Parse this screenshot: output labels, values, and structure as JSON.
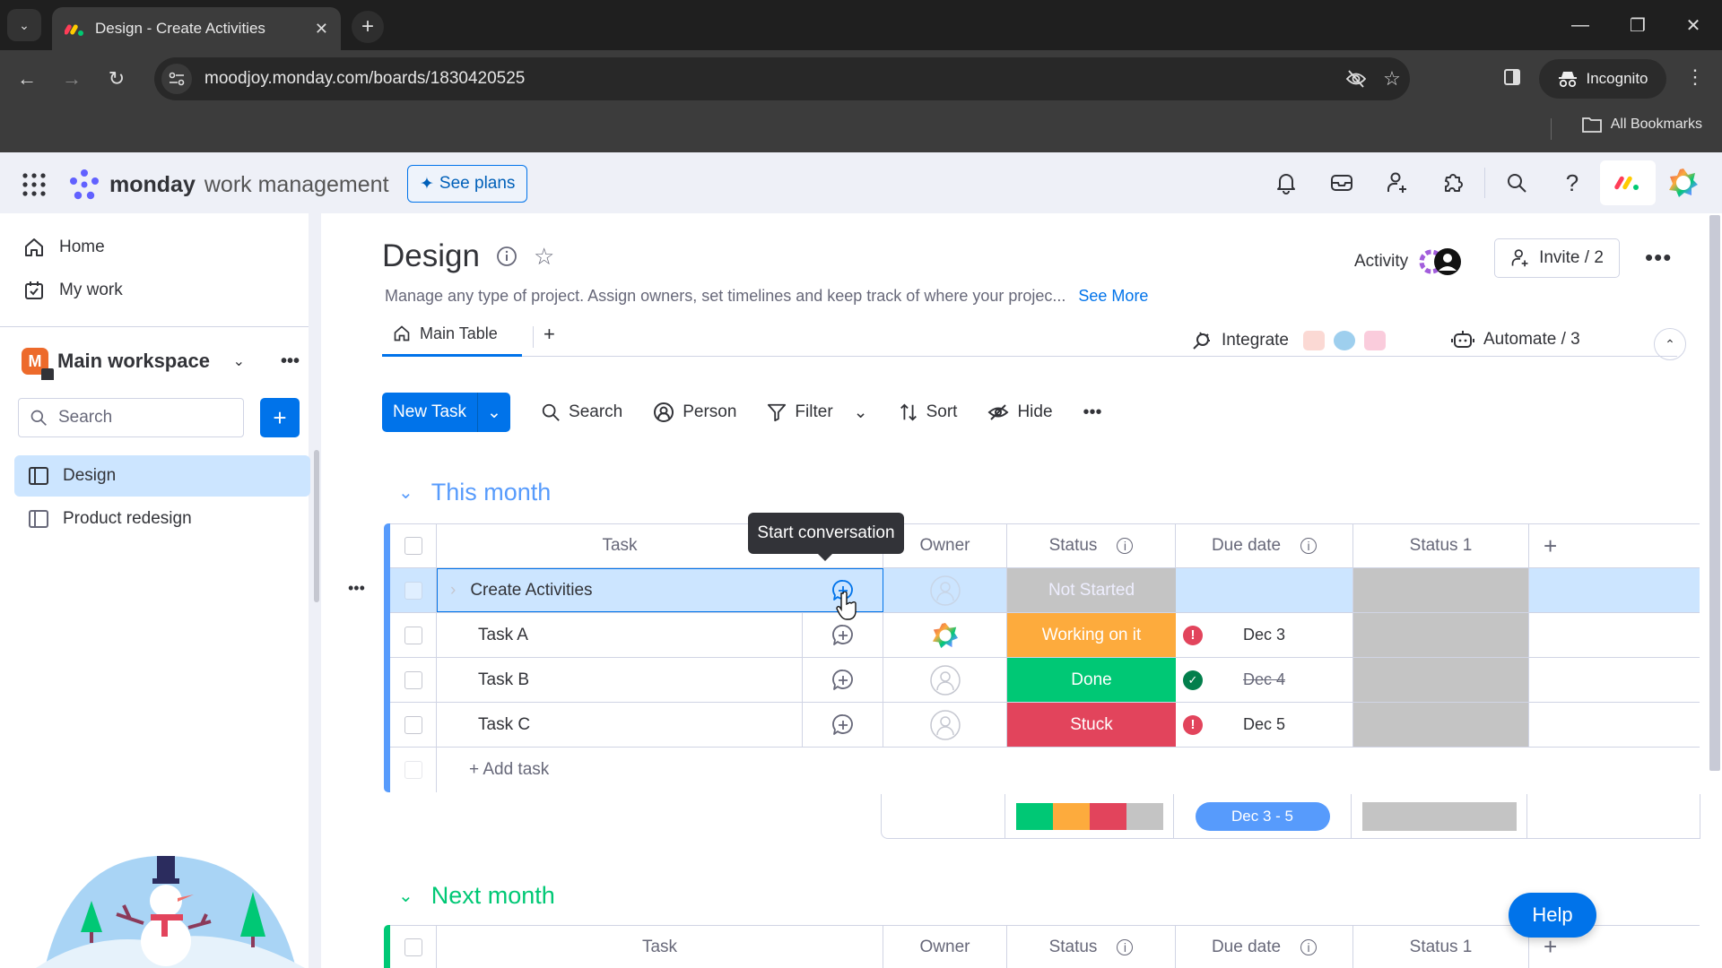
{
  "browser": {
    "tab_title": "Design - Create Activities",
    "url": "moodjoy.monday.com/boards/1830420525",
    "incognito_label": "Incognito",
    "bookmarks_label": "All Bookmarks"
  },
  "app": {
    "brand_bold": "monday",
    "brand_light": "work management",
    "see_plans": "See plans",
    "header_icons": [
      "bell-icon",
      "inbox-icon",
      "invite-members-icon",
      "apps-icon",
      "search-icon",
      "help-icon"
    ]
  },
  "sidebar": {
    "nav": [
      {
        "label": "Home",
        "icon": "home-icon"
      },
      {
        "label": "My work",
        "icon": "calendar-check-icon"
      }
    ],
    "workspace": {
      "badge": "M",
      "name": "Main workspace"
    },
    "search_placeholder": "Search",
    "boards": [
      {
        "label": "Design",
        "selected": true
      },
      {
        "label": "Product redesign",
        "selected": false
      }
    ]
  },
  "board": {
    "title": "Design",
    "description": "Manage any type of project. Assign owners, set timelines and keep track of where your projec...",
    "see_more": "See More",
    "activity_label": "Activity",
    "invite_label": "Invite / 2",
    "tabs": [
      {
        "label": "Main Table",
        "active": true
      }
    ],
    "integrate_label": "Integrate",
    "automate_label": "Automate / 3",
    "actions": {
      "new_task": "New Task",
      "search": "Search",
      "person": "Person",
      "filter": "Filter",
      "sort": "Sort",
      "hide": "Hide"
    },
    "columns": {
      "task": "Task",
      "owner": "Owner",
      "status": "Status",
      "due_date": "Due date",
      "status1": "Status 1"
    },
    "tooltip": "Start conversation",
    "groups": [
      {
        "name": "This month",
        "color": "#579bfc",
        "rows": [
          {
            "task": "Create Activities",
            "owner": "empty",
            "status": "Not Started",
            "status_color": "#c4c4c4",
            "due": "",
            "due_flag": "",
            "selected": true
          },
          {
            "task": "Task A",
            "owner": "avatar",
            "status": "Working on it",
            "status_color": "#fdab3d",
            "due": "Dec 3",
            "due_flag": "overdue",
            "selected": false
          },
          {
            "task": "Task B",
            "owner": "empty",
            "status": "Done",
            "status_color": "#00c875",
            "due": "Dec 4",
            "due_flag": "done",
            "selected": false
          },
          {
            "task": "Task C",
            "owner": "empty",
            "status": "Stuck",
            "status_color": "#e2445c",
            "due": "Dec 5",
            "due_flag": "overdue",
            "selected": false
          }
        ],
        "add_task": "+ Add task",
        "summary": {
          "status_distribution": [
            {
              "status": "Done",
              "color": "#00c875",
              "share": 0.25
            },
            {
              "status": "Working on it",
              "color": "#fdab3d",
              "share": 0.25
            },
            {
              "status": "Stuck",
              "color": "#e2445c",
              "share": 0.25
            },
            {
              "status": "Not Started",
              "color": "#c4c4c4",
              "share": 0.25
            }
          ],
          "date_range": "Dec 3 - 5"
        }
      },
      {
        "name": "Next month",
        "color": "#00c875"
      }
    ]
  },
  "help_label": "Help"
}
